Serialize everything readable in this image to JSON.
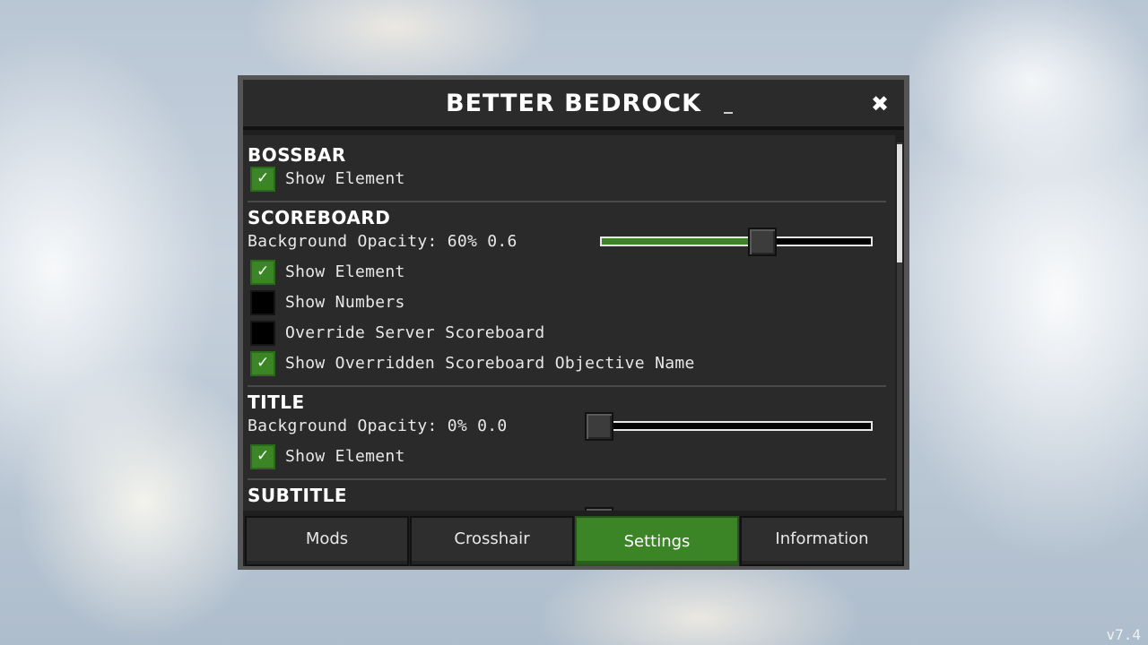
{
  "window": {
    "title": "BETTER BEDROCK",
    "close_icon": "close-icon"
  },
  "sections": {
    "bossbar": {
      "title": "BOSSBAR",
      "show_element": {
        "label": "Show Element",
        "checked": true
      }
    },
    "scoreboard": {
      "title": "SCOREBOARD",
      "opacity": {
        "label": "Background Opacity: 60% 0.6",
        "value": 0.6
      },
      "show_element": {
        "label": "Show Element",
        "checked": true
      },
      "show_numbers": {
        "label": "Show Numbers",
        "checked": false
      },
      "override_server": {
        "label": "Override Server Scoreboard",
        "checked": false
      },
      "show_overridden": {
        "label": "Show Overridden Scoreboard Objective Name",
        "checked": true
      }
    },
    "title": {
      "title": "TITLE",
      "opacity": {
        "label": "Background Opacity: 0% 0.0",
        "value": 0.0
      },
      "show_element": {
        "label": "Show Element",
        "checked": true
      }
    },
    "subtitle": {
      "title": "SUBTITLE",
      "opacity": {
        "value": 0.0
      }
    }
  },
  "tabs": [
    {
      "label": "Mods",
      "active": false
    },
    {
      "label": "Crosshair",
      "active": false
    },
    {
      "label": "Settings",
      "active": true
    },
    {
      "label": "Information",
      "active": false
    }
  ],
  "version": "v7.4",
  "colors": {
    "accent_green": "#3c8527",
    "panel_bg": "#1f1f1f",
    "content_bg": "#2a2a2a"
  }
}
